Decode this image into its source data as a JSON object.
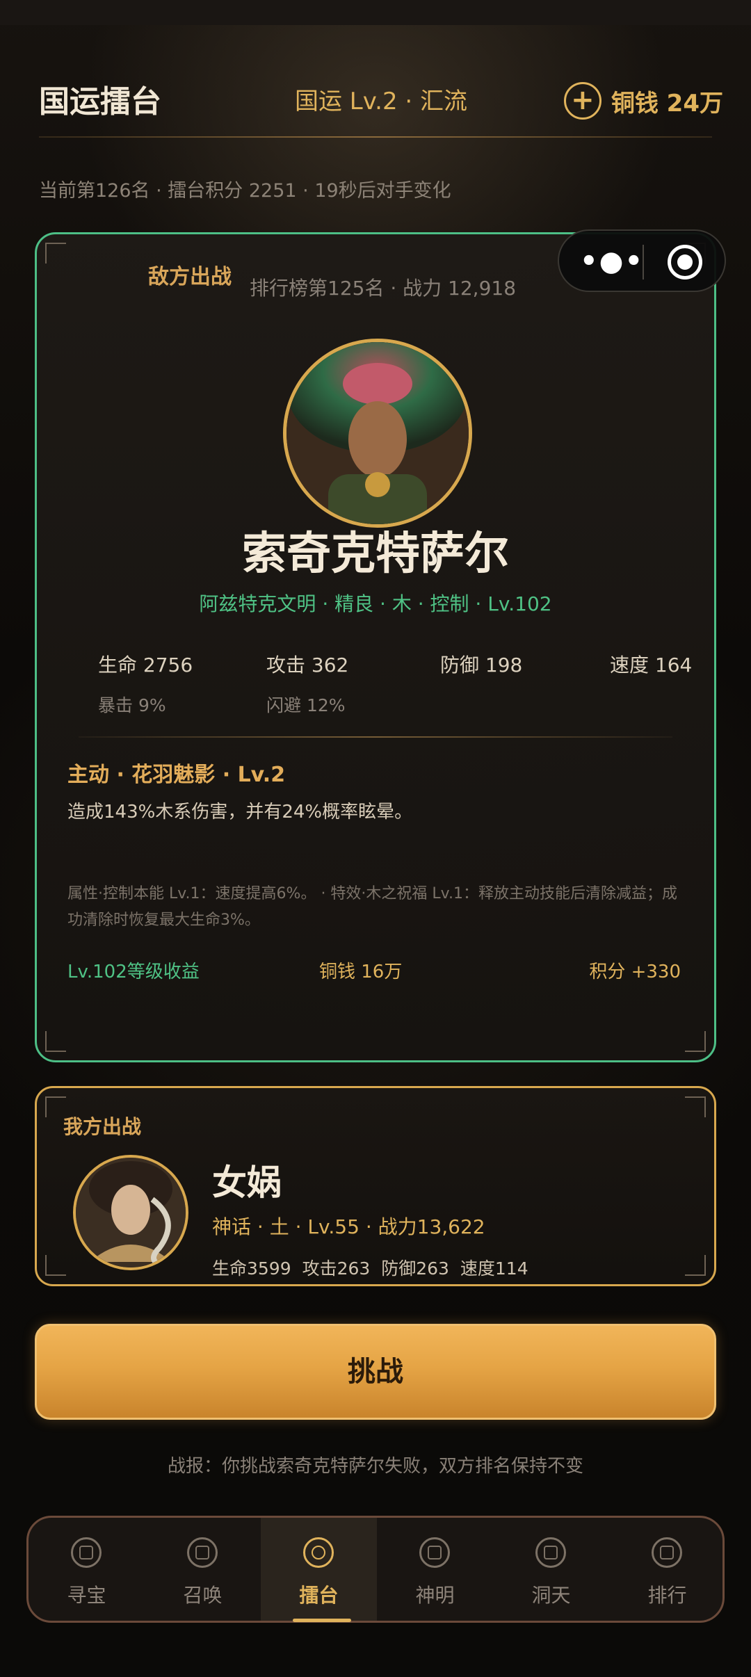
{
  "header": {
    "title": "国运擂台",
    "realm": "国运 Lv.2 · 汇流",
    "plus": "+",
    "coins": "铜钱 24万"
  },
  "rank_line": "当前第126名 · 擂台积分 2251 · 19秒后对手变化",
  "capsule": {
    "dots": "•●•"
  },
  "enemy": {
    "label": "敌方出战",
    "rank": "排行榜第125名 · 战力 12,918",
    "name": "索奇克特萨尔",
    "meta": "阿兹特克文明 · 精良 · 木 · 控制 · Lv.102",
    "stats": {
      "hp": "生命 2756",
      "atk": "攻击 362",
      "def": "防御 198",
      "spd": "速度 164",
      "crit": "暴击 9%",
      "dodge": "闪避 12%"
    },
    "skill": {
      "title": "主动 · 花羽魅影 · Lv.2",
      "desc": "造成143%木系伤害，并有24%概率眩晕。",
      "note": "属性·控制本能 Lv.1：速度提高6%。 · 特效·木之祝福 Lv.1：释放主动技能后清除减益；成功清除时恢复最大生命3%。"
    },
    "rewards": {
      "level": "Lv.102等级收益",
      "coins": "铜钱 16万",
      "points": "积分 +330"
    }
  },
  "mine": {
    "label": "我方出战",
    "name": "女娲",
    "meta": "神话 · 土 · Lv.55 · 战力13,622",
    "stats": "生命3599 攻击263 防御263 速度114"
  },
  "challenge_label": "挑战",
  "battle_report": "战报：你挑战索奇克特萨尔失败，双方排名保持不变",
  "nav": {
    "items": [
      {
        "label": "寻宝",
        "icon": "treasure-icon"
      },
      {
        "label": "召唤",
        "icon": "summon-icon"
      },
      {
        "label": "擂台",
        "icon": "arena-icon"
      },
      {
        "label": "神明",
        "icon": "deity-icon"
      },
      {
        "label": "洞天",
        "icon": "cave-icon"
      },
      {
        "label": "排行",
        "icon": "ranking-icon"
      }
    ],
    "active_index": 2
  },
  "colors": {
    "accent_gold": "#e0b35c",
    "enemy_border": "#4dbf86",
    "green_text": "#4fc285"
  }
}
